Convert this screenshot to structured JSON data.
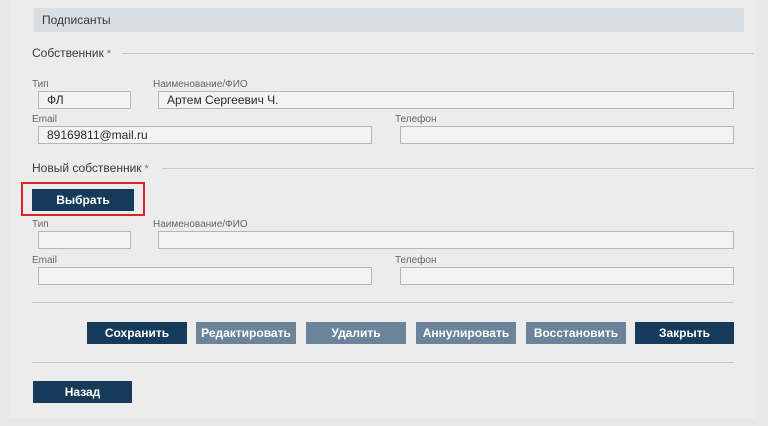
{
  "section": {
    "title": "Подписанты"
  },
  "owner": {
    "title": "Собственник",
    "required_mark": "*",
    "type_label": "Тип",
    "type_value": "ФЛ",
    "name_label": "Наименование/ФИО",
    "name_value": "Артем Сергеевич Ч.",
    "email_label": "Email",
    "email_value": "89169811@mail.ru",
    "phone_label": "Телефон",
    "phone_value": ""
  },
  "new_owner": {
    "title": "Новый собственник",
    "required_mark": "*",
    "select_button": "Выбрать",
    "type_label": "Тип",
    "type_value": "",
    "name_label": "Наименование/ФИО",
    "name_value": "",
    "email_label": "Email",
    "email_value": "",
    "phone_label": "Телефон",
    "phone_value": ""
  },
  "actions": {
    "save": "Сохранить",
    "edit": "Редактировать",
    "delete": "Удалить",
    "annul": "Аннулировать",
    "restore": "Восстановить",
    "close": "Закрыть"
  },
  "footer": {
    "back": "Назад"
  },
  "colors": {
    "primary_button": "#163b5a",
    "disabled_button": "#6c8499",
    "highlight": "#d8252b",
    "section_header_bg": "#d9dee3"
  }
}
